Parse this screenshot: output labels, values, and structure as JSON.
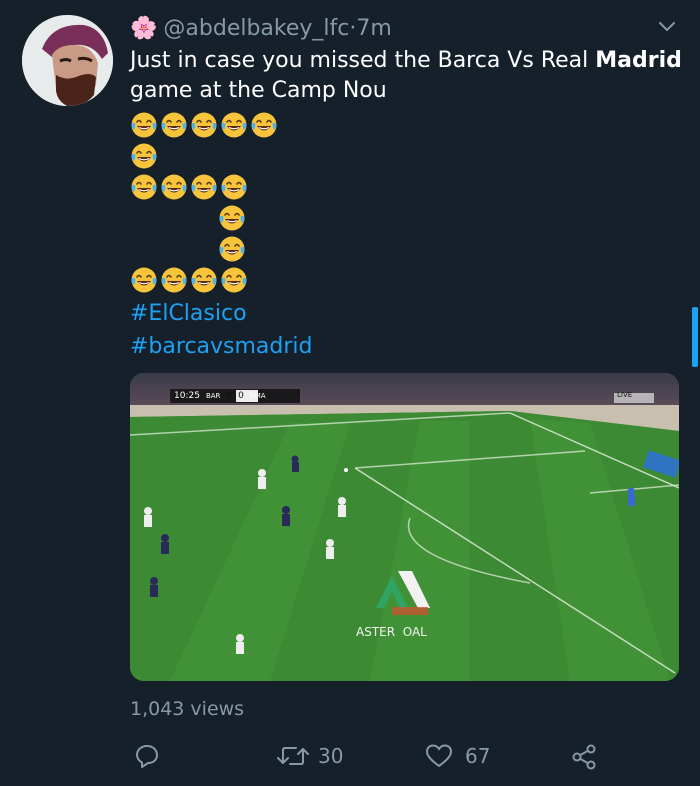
{
  "tweet": {
    "flower_glyph": "🌸",
    "handle": "@abdelbakey_lfc",
    "separator": " · ",
    "time": "7m",
    "text_part1": "Just in case you missed the Barca Vs Real ",
    "text_bold": "Madrid",
    "text_part2": " game at the Camp Nou",
    "hashtags": [
      "#ElClasico",
      "#barcavsmadrid"
    ],
    "emoji_name": "face-with-tears-of-joy",
    "emoji_rows": [
      5,
      1,
      4,
      1,
      1,
      4
    ]
  },
  "video": {
    "clock": "10:25",
    "home_team": "BAR",
    "home_score": "0",
    "away_score": "0",
    "away_team": "RMA",
    "live_badge": "LIVE",
    "watermark": "ASTER  OAL"
  },
  "stats": {
    "views": "1,043 views",
    "retweets": "30",
    "likes": "67"
  },
  "colors": {
    "background": "#15202b",
    "secondary_text": "#8899a6",
    "link": "#1da1f2"
  }
}
